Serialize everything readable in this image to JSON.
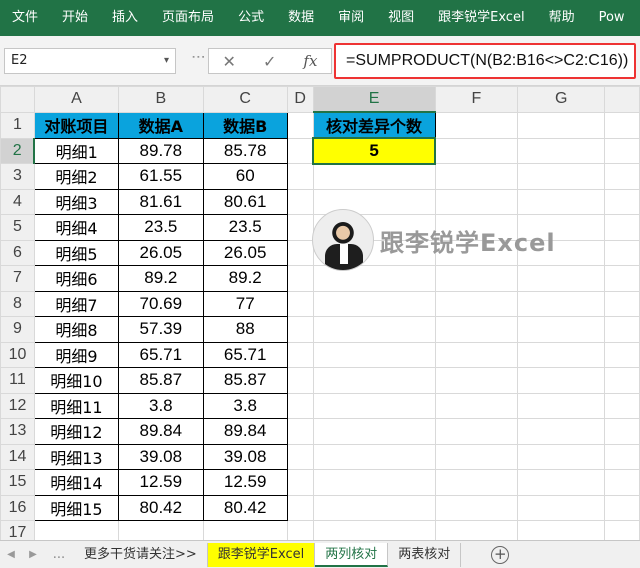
{
  "ribbon": {
    "tabs": [
      "文件",
      "开始",
      "插入",
      "页面布局",
      "公式",
      "数据",
      "审阅",
      "视图",
      "跟李锐学Excel",
      "帮助",
      "Pow"
    ]
  },
  "formula_bar": {
    "name_box": "E2",
    "name_arrow": "▾",
    "cancel_icon": "✕",
    "enter_icon": "✓",
    "fx_label": "fx",
    "formula": "=SUMPRODUCT(N(B2:B16<>C2:C16))"
  },
  "columns": [
    "A",
    "B",
    "C",
    "D",
    "E",
    "F",
    "G"
  ],
  "rows": [
    "1",
    "2",
    "3",
    "4",
    "5",
    "6",
    "7",
    "8",
    "9",
    "10",
    "11",
    "12",
    "13",
    "14",
    "15",
    "16",
    "17"
  ],
  "table": {
    "headers": [
      "对账项目",
      "数据A",
      "数据B"
    ],
    "rows": [
      [
        "明细1",
        "89.78",
        "85.78"
      ],
      [
        "明细2",
        "61.55",
        "60"
      ],
      [
        "明细3",
        "81.61",
        "80.61"
      ],
      [
        "明细4",
        "23.5",
        "23.5"
      ],
      [
        "明细5",
        "26.05",
        "26.05"
      ],
      [
        "明细6",
        "89.2",
        "89.2"
      ],
      [
        "明细7",
        "70.69",
        "77"
      ],
      [
        "明细8",
        "57.39",
        "88"
      ],
      [
        "明细9",
        "65.71",
        "65.71"
      ],
      [
        "明细10",
        "85.87",
        "85.87"
      ],
      [
        "明细11",
        "3.8",
        "3.8"
      ],
      [
        "明细12",
        "89.84",
        "89.84"
      ],
      [
        "明细13",
        "39.08",
        "39.08"
      ],
      [
        "明细14",
        "12.59",
        "12.59"
      ],
      [
        "明细15",
        "80.42",
        "80.42"
      ]
    ]
  },
  "result": {
    "header": "核对差异个数",
    "value": "5"
  },
  "watermark": {
    "text": "跟李锐学Excel"
  },
  "sheet_tabs": {
    "prev": "◀",
    "next": "▶",
    "more": "...",
    "tabs": [
      "更多干货请关注>>",
      "跟李锐学Excel",
      "两列核对",
      "两表核对"
    ],
    "add": "+"
  },
  "colors": {
    "ribbon": "#217346",
    "header_fill": "#0aa3dd",
    "result_fill": "#ffff00",
    "formula_highlight": "#e33333"
  }
}
